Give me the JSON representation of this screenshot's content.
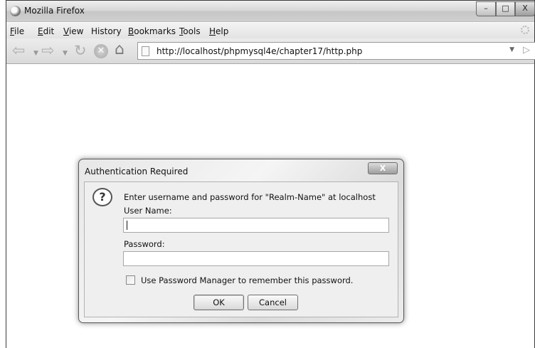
{
  "window": {
    "title": "Mozilla Firefox",
    "controls": {
      "minimize": "–",
      "maximize": "□",
      "close": "X"
    }
  },
  "menubar": {
    "items": [
      {
        "label": "File",
        "mnemonic": "F",
        "rest": "ile"
      },
      {
        "label": "Edit",
        "mnemonic": "E",
        "rest": "dit"
      },
      {
        "label": "View",
        "mnemonic": "V",
        "rest": "iew"
      },
      {
        "label": "History",
        "mnemonic": "",
        "rest": "History"
      },
      {
        "label": "Bookmarks",
        "mnemonic": "B",
        "rest": "ookmarks"
      },
      {
        "label": "Tools",
        "mnemonic": "T",
        "rest": "ools"
      },
      {
        "label": "Help",
        "mnemonic": "H",
        "rest": "elp"
      }
    ]
  },
  "navbar": {
    "icons": [
      "back-arrow-icon",
      "forward-arrow-icon",
      "reload-icon",
      "stop-icon",
      "home-icon",
      "page-icon",
      "go-arrow-icon"
    ],
    "url": "http://localhost/phpmysql4e/chapter17/http.php"
  },
  "dialog": {
    "title": "Authentication Required",
    "close_label": "X",
    "icon": "question-icon",
    "prompt": "Enter username and password for \"Realm-Name\" at localhost",
    "username_label": "User Name:",
    "username_value": "",
    "password_label": "Password:",
    "password_value": "",
    "remember_label": "Use Password Manager to remember this password.",
    "remember_checked": false,
    "ok_label": "OK",
    "cancel_label": "Cancel"
  }
}
